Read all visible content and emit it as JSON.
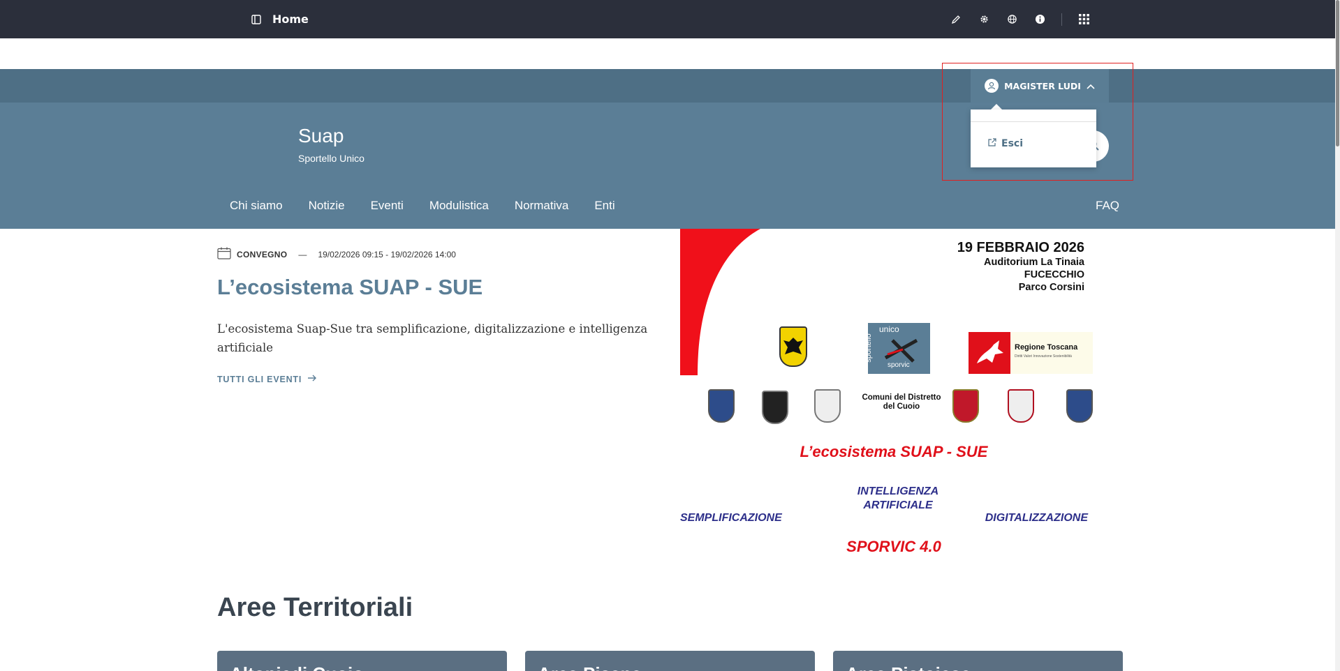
{
  "admin_bar": {
    "title": "Home",
    "icons": [
      "sidebar-toggle-icon",
      "pencil-icon",
      "gear-icon",
      "globe-icon",
      "info-icon",
      "apps-grid-icon"
    ]
  },
  "slim_header": {
    "user_name": "MAGISTER LUDI"
  },
  "user_menu": {
    "items": [
      {
        "label": "Esci",
        "icon": "external-link-icon"
      }
    ]
  },
  "brand": {
    "title": "Suap",
    "subtitle": "Sportello Unico"
  },
  "nav": {
    "items": [
      {
        "label": "Chi siamo"
      },
      {
        "label": "Notizie"
      },
      {
        "label": "Eventi"
      },
      {
        "label": "Modulistica"
      },
      {
        "label": "Normativa"
      },
      {
        "label": "Enti"
      }
    ],
    "faq": "FAQ"
  },
  "hero": {
    "category": "CONVEGNO",
    "separator": "—",
    "dates": "19/02/2026 09:15 - 19/02/2026 14:00",
    "title": "L’ecosistema SUAP - SUE",
    "description": "L'ecosistema Suap-Sue tra semplificazione, digitalizzazione e intelligenza artificiale",
    "link_label": "TUTTI GLI EVENTI"
  },
  "poster": {
    "date": "19 FEBBRAIO 2026",
    "lines": [
      "Auditorium La Tinaia",
      "FUCECCHIO",
      "Parco Corsini"
    ],
    "sportello": [
      "sportello",
      "unico",
      "sporvic"
    ],
    "regione": "Regione Toscana",
    "regione_sub": "Diritti Valori Innovazione Sostenibilità",
    "districts": "Comuni del Distretto del Cuoio",
    "main": "L’ecosistema SUAP - SUE",
    "ia": "INTELLIGENZA ARTIFICIALE",
    "sempl": "SEMPLIFICAZIONE",
    "digit": "DIGITALIZZAZIONE",
    "sporvic": "SPORVIC 4.0"
  },
  "areas": {
    "title": "Aree Territoriali",
    "cards": [
      {
        "label": "Altopiedi Cuoio"
      },
      {
        "label": "Area Pisana"
      },
      {
        "label": "Area Pistoiese"
      }
    ]
  },
  "colors": {
    "admin_bg": "#2b2f3b",
    "slim_header": "#4e6f85",
    "center_header": "#5b7e96",
    "accent_red": "#e0101a",
    "poster_blue": "#2d2f8a"
  }
}
